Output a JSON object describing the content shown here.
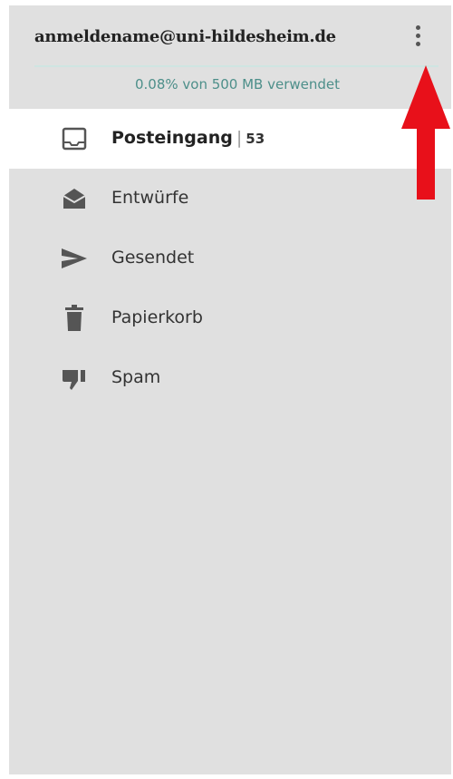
{
  "account": {
    "email": "anmeldename@uni-hildesheim.de",
    "quota": "0.08% von 500 MB verwendet"
  },
  "folders": [
    {
      "label": "Posteingang",
      "count": "53",
      "icon": "inbox-icon"
    },
    {
      "label": "Entwürfe",
      "icon": "drafts-icon"
    },
    {
      "label": "Gesendet",
      "icon": "send-icon"
    },
    {
      "label": "Papierkorb",
      "icon": "trash-icon"
    },
    {
      "label": "Spam",
      "icon": "thumbs-down-icon"
    }
  ],
  "colors": {
    "drawer_bg": "#e0e0e0",
    "active_bg": "#ffffff",
    "quota_text": "#4d8f8a",
    "divider": "#cfe5e2",
    "annotation_arrow": "#e8101a"
  }
}
